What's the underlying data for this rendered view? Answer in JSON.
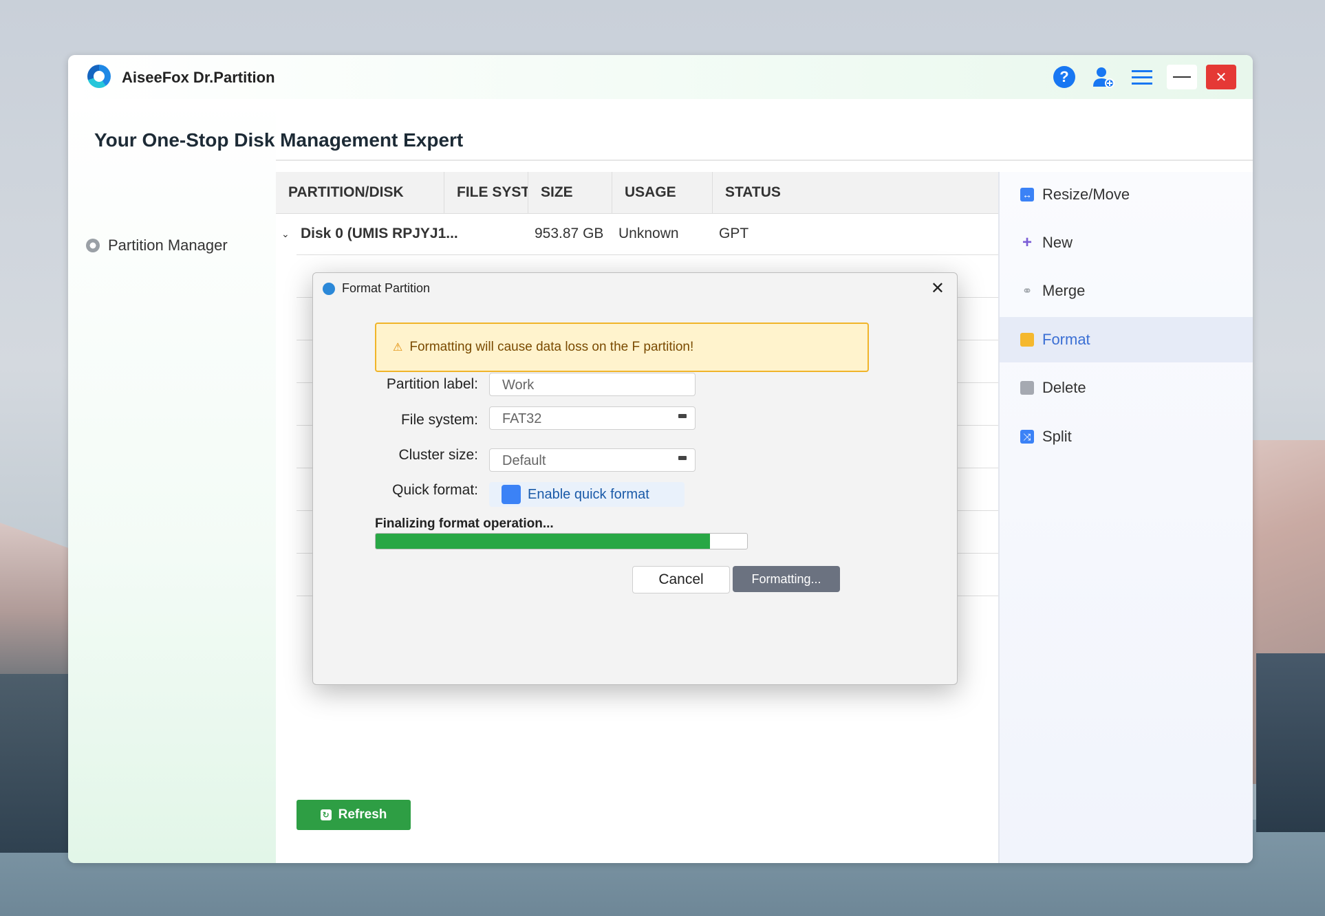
{
  "app": {
    "title": "AiseeFox Dr.Partition",
    "main_title": "Your One-Stop Disk Management Expert"
  },
  "sidebar": {
    "items": [
      {
        "label": "Partition Manager",
        "icon": "gear-icon"
      }
    ]
  },
  "titlebar": {
    "icons": [
      "help-icon",
      "add-user-icon",
      "menu-icon",
      "minimize-icon",
      "close-icon"
    ],
    "help_glyph": "?",
    "close_glyph": "✕"
  },
  "table": {
    "headers": [
      "PARTITION/DISK",
      "FILE SYSTEM",
      "SIZE",
      "USAGE",
      "STATUS"
    ],
    "rows": [
      {
        "partition": "Disk 0 (UMIS RPJYJ1...",
        "file_system": "",
        "size": "953.87 GB",
        "usage": "Unknown",
        "status": "GPT",
        "expander": "⌄"
      }
    ]
  },
  "actions": [
    {
      "label": "Resize/Move",
      "icon": "resize-move-icon",
      "active": false
    },
    {
      "label": "New",
      "icon": "plus-icon",
      "active": false
    },
    {
      "label": "Merge",
      "icon": "link-icon",
      "active": false
    },
    {
      "label": "Format",
      "icon": "folder-icon",
      "active": true
    },
    {
      "label": "Delete",
      "icon": "trash-icon",
      "active": false
    },
    {
      "label": "Split",
      "icon": "split-icon",
      "active": false
    }
  ],
  "refresh_button": {
    "label": "Refresh",
    "icon": "refresh-icon"
  },
  "modal": {
    "title": "Format Partition",
    "close_glyph": "✕",
    "warning": "Formatting will cause data loss on the F partition!",
    "warning_glyph": "⚠",
    "fields": {
      "partition_label": {
        "label": "Partition label:",
        "value": "Work"
      },
      "file_system": {
        "label": "File system:",
        "value": "FAT32"
      },
      "cluster_size": {
        "label": "Cluster size:",
        "value": "Default"
      },
      "quick_format": {
        "label": "Quick format:",
        "option": "Enable quick format",
        "checked": true
      }
    },
    "progress": {
      "label": "Finalizing format operation...",
      "percent": 90
    },
    "buttons": {
      "cancel": "Cancel",
      "formatting": "Formatting..."
    }
  },
  "colors": {
    "accent": "#1877f2",
    "active_action": "#3b6fd4",
    "progress": "#28a745",
    "refresh": "#2e9e44",
    "warning_bg": "#fff3cd",
    "close": "#e53935"
  }
}
